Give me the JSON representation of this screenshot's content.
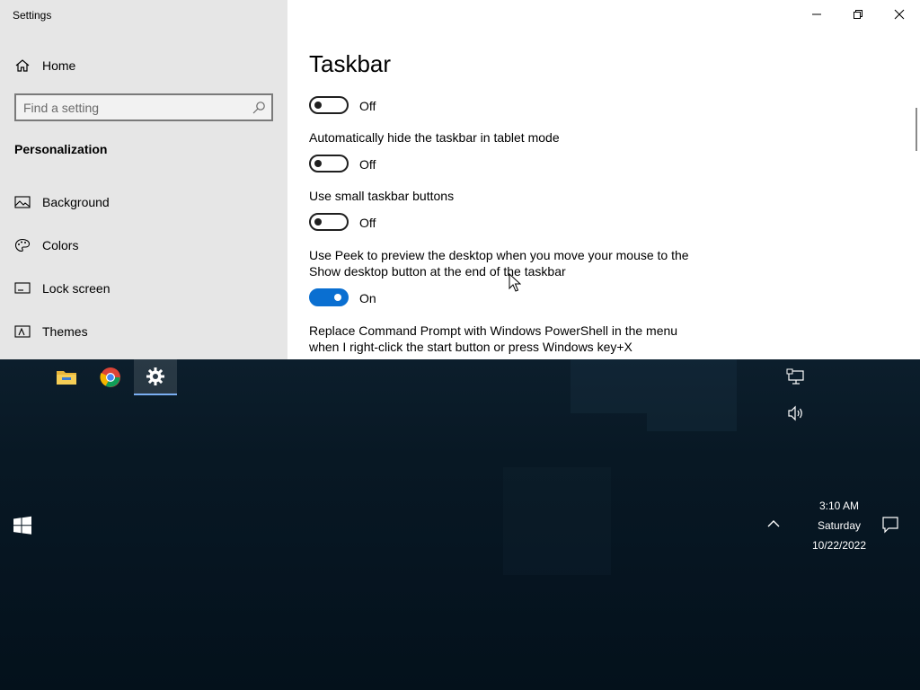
{
  "window": {
    "title": "Settings"
  },
  "sidebar": {
    "home_label": "Home",
    "search_placeholder": "Find a setting",
    "section": "Personalization",
    "items": [
      {
        "label": "Background",
        "icon": "picture-icon"
      },
      {
        "label": "Colors",
        "icon": "palette-icon"
      },
      {
        "label": "Lock screen",
        "icon": "lock-screen-icon"
      },
      {
        "label": "Themes",
        "icon": "themes-icon"
      }
    ]
  },
  "content": {
    "title": "Taskbar",
    "settings": [
      {
        "label": "",
        "state": "Off",
        "on": false
      },
      {
        "label": "Automatically hide the taskbar in tablet mode",
        "state": "Off",
        "on": false
      },
      {
        "label": "Use small taskbar buttons",
        "state": "Off",
        "on": false
      },
      {
        "label": "Use Peek to preview the desktop when you move your mouse to the Show desktop button at the end of the taskbar",
        "state": "On",
        "on": true
      },
      {
        "label": "Replace Command Prompt with Windows PowerShell in the menu when I right-click the start button or press Windows key+X",
        "state": "",
        "on": null
      }
    ]
  },
  "taskbar": {
    "apps": [
      "file-explorer-icon",
      "chrome-icon",
      "settings-gear-icon"
    ],
    "clock": {
      "time": "3:10 AM",
      "day": "Saturday",
      "date": "10/22/2022"
    }
  },
  "colors": {
    "accent": "#0a6fd1",
    "sidebar_bg": "#e6e6e6",
    "desktop_bg": "#04111c"
  }
}
